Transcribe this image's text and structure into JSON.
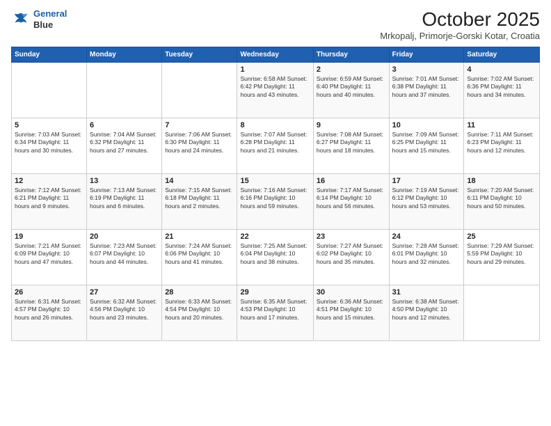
{
  "logo": {
    "line1": "General",
    "line2": "Blue"
  },
  "title": "October 2025",
  "location": "Mrkopalj, Primorje-Gorski Kotar, Croatia",
  "weekdays": [
    "Sunday",
    "Monday",
    "Tuesday",
    "Wednesday",
    "Thursday",
    "Friday",
    "Saturday"
  ],
  "weeks": [
    [
      {
        "day": "",
        "content": ""
      },
      {
        "day": "",
        "content": ""
      },
      {
        "day": "",
        "content": ""
      },
      {
        "day": "1",
        "content": "Sunrise: 6:58 AM\nSunset: 6:42 PM\nDaylight: 11 hours\nand 43 minutes."
      },
      {
        "day": "2",
        "content": "Sunrise: 6:59 AM\nSunset: 6:40 PM\nDaylight: 11 hours\nand 40 minutes."
      },
      {
        "day": "3",
        "content": "Sunrise: 7:01 AM\nSunset: 6:38 PM\nDaylight: 11 hours\nand 37 minutes."
      },
      {
        "day": "4",
        "content": "Sunrise: 7:02 AM\nSunset: 6:36 PM\nDaylight: 11 hours\nand 34 minutes."
      }
    ],
    [
      {
        "day": "5",
        "content": "Sunrise: 7:03 AM\nSunset: 6:34 PM\nDaylight: 11 hours\nand 30 minutes."
      },
      {
        "day": "6",
        "content": "Sunrise: 7:04 AM\nSunset: 6:32 PM\nDaylight: 11 hours\nand 27 minutes."
      },
      {
        "day": "7",
        "content": "Sunrise: 7:06 AM\nSunset: 6:30 PM\nDaylight: 11 hours\nand 24 minutes."
      },
      {
        "day": "8",
        "content": "Sunrise: 7:07 AM\nSunset: 6:28 PM\nDaylight: 11 hours\nand 21 minutes."
      },
      {
        "day": "9",
        "content": "Sunrise: 7:08 AM\nSunset: 6:27 PM\nDaylight: 11 hours\nand 18 minutes."
      },
      {
        "day": "10",
        "content": "Sunrise: 7:09 AM\nSunset: 6:25 PM\nDaylight: 11 hours\nand 15 minutes."
      },
      {
        "day": "11",
        "content": "Sunrise: 7:11 AM\nSunset: 6:23 PM\nDaylight: 11 hours\nand 12 minutes."
      }
    ],
    [
      {
        "day": "12",
        "content": "Sunrise: 7:12 AM\nSunset: 6:21 PM\nDaylight: 11 hours\nand 9 minutes."
      },
      {
        "day": "13",
        "content": "Sunrise: 7:13 AM\nSunset: 6:19 PM\nDaylight: 11 hours\nand 6 minutes."
      },
      {
        "day": "14",
        "content": "Sunrise: 7:15 AM\nSunset: 6:18 PM\nDaylight: 11 hours\nand 2 minutes."
      },
      {
        "day": "15",
        "content": "Sunrise: 7:16 AM\nSunset: 6:16 PM\nDaylight: 10 hours\nand 59 minutes."
      },
      {
        "day": "16",
        "content": "Sunrise: 7:17 AM\nSunset: 6:14 PM\nDaylight: 10 hours\nand 56 minutes."
      },
      {
        "day": "17",
        "content": "Sunrise: 7:19 AM\nSunset: 6:12 PM\nDaylight: 10 hours\nand 53 minutes."
      },
      {
        "day": "18",
        "content": "Sunrise: 7:20 AM\nSunset: 6:11 PM\nDaylight: 10 hours\nand 50 minutes."
      }
    ],
    [
      {
        "day": "19",
        "content": "Sunrise: 7:21 AM\nSunset: 6:09 PM\nDaylight: 10 hours\nand 47 minutes."
      },
      {
        "day": "20",
        "content": "Sunrise: 7:23 AM\nSunset: 6:07 PM\nDaylight: 10 hours\nand 44 minutes."
      },
      {
        "day": "21",
        "content": "Sunrise: 7:24 AM\nSunset: 6:06 PM\nDaylight: 10 hours\nand 41 minutes."
      },
      {
        "day": "22",
        "content": "Sunrise: 7:25 AM\nSunset: 6:04 PM\nDaylight: 10 hours\nand 38 minutes."
      },
      {
        "day": "23",
        "content": "Sunrise: 7:27 AM\nSunset: 6:02 PM\nDaylight: 10 hours\nand 35 minutes."
      },
      {
        "day": "24",
        "content": "Sunrise: 7:28 AM\nSunset: 6:01 PM\nDaylight: 10 hours\nand 32 minutes."
      },
      {
        "day": "25",
        "content": "Sunrise: 7:29 AM\nSunset: 5:59 PM\nDaylight: 10 hours\nand 29 minutes."
      }
    ],
    [
      {
        "day": "26",
        "content": "Sunrise: 6:31 AM\nSunset: 4:57 PM\nDaylight: 10 hours\nand 26 minutes."
      },
      {
        "day": "27",
        "content": "Sunrise: 6:32 AM\nSunset: 4:56 PM\nDaylight: 10 hours\nand 23 minutes."
      },
      {
        "day": "28",
        "content": "Sunrise: 6:33 AM\nSunset: 4:54 PM\nDaylight: 10 hours\nand 20 minutes."
      },
      {
        "day": "29",
        "content": "Sunrise: 6:35 AM\nSunset: 4:53 PM\nDaylight: 10 hours\nand 17 minutes."
      },
      {
        "day": "30",
        "content": "Sunrise: 6:36 AM\nSunset: 4:51 PM\nDaylight: 10 hours\nand 15 minutes."
      },
      {
        "day": "31",
        "content": "Sunrise: 6:38 AM\nSunset: 4:50 PM\nDaylight: 10 hours\nand 12 minutes."
      },
      {
        "day": "",
        "content": ""
      }
    ]
  ]
}
